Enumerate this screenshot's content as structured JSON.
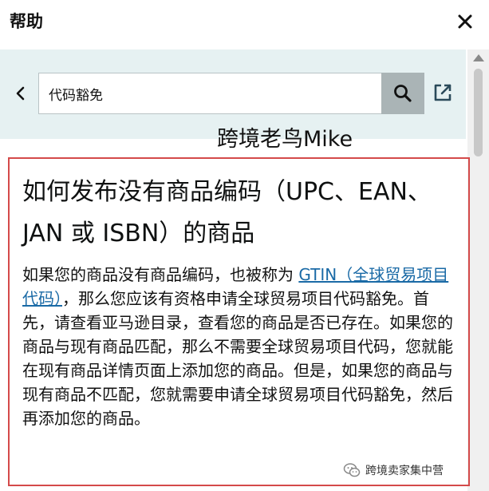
{
  "header": {
    "title": "帮助"
  },
  "search": {
    "value": "代码豁免"
  },
  "watermark": {
    "top_text": "跨境老鸟Mike",
    "footer_text": "跨境卖家集中营"
  },
  "article": {
    "title": "如何发布没有商品编码（UPC、EAN、JAN 或 ISBN）的商品",
    "body_before": "如果您的商品没有商品编码，也被称为 ",
    "link_text": "GTIN（全球贸易项目代码）",
    "body_after": "，那么您应该有资格申请全球贸易项目代码豁免。首先，请查看亚马逊目录，查看您的商品是否已存在。如果您的商品与现有商品匹配，那么不需要全球贸易项目代码，您就能在现有商品详情页面上添加您的商品。但是，如果您的商品与现有商品不匹配，您就需要申请全球贸易项目代码豁免，然后再添加您的商品。"
  },
  "colors": {
    "accent_band": "#e6f1f2",
    "search_button": "#aab4b6",
    "link": "#1a6aa6",
    "highlight_border": "#d44a4a"
  },
  "icons": {
    "close": "close-icon",
    "back": "chevron-left-icon",
    "search": "search-icon",
    "external": "external-link-icon"
  }
}
